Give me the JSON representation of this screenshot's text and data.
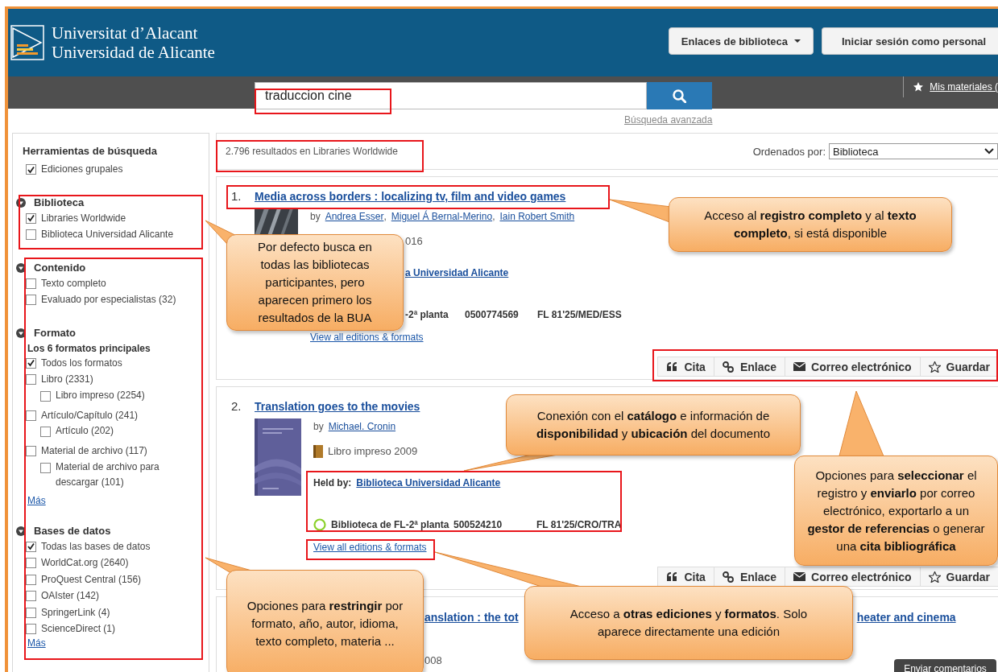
{
  "header": {
    "logo_lines": [
      "Universitat d’Alacant",
      "Universidad de Alicante"
    ],
    "buttons": [
      {
        "label": "Enlaces de biblioteca",
        "kind": "dropdown"
      },
      {
        "label": "Iniciar sesión como personal",
        "kind": "plain"
      }
    ]
  },
  "search": {
    "value": "traduccion cine",
    "advanced_link": "Búsqueda avanzada",
    "my_materials": "Mis materiales ("
  },
  "sidebar": {
    "title": "Herramientas de búsqueda",
    "options": [
      {
        "label": "Ediciones grupales",
        "checked": true
      }
    ],
    "sections": [
      {
        "title": "Biblioteca",
        "items": [
          {
            "label": "Libraries Worldwide",
            "checked": true
          },
          {
            "label": "Biblioteca Universidad Alicante",
            "checked": false
          }
        ]
      },
      {
        "title": "Contenido",
        "items": [
          {
            "label": "Texto completo",
            "checked": false
          },
          {
            "label": "Evaluado por especialistas (32)",
            "checked": false
          }
        ]
      },
      {
        "title": "Formato",
        "subtitle": "Los 6 formatos principales",
        "items": [
          {
            "label": "Todos los formatos",
            "checked": true
          },
          {
            "label": "Libro (2331)",
            "checked": false,
            "children": [
              {
                "label": "Libro impreso (2254)",
                "checked": false
              }
            ]
          },
          {
            "label": "Artículo/Capítulo (241)",
            "checked": false,
            "children": [
              {
                "label": "Artículo (202)",
                "checked": false
              }
            ]
          },
          {
            "label": "Material de archivo (117)",
            "checked": false,
            "children": [
              {
                "label": "Material de archivo para descargar (101)",
                "checked": false
              }
            ]
          }
        ],
        "more": "Más"
      },
      {
        "title": "Bases de datos",
        "items": [
          {
            "label": "Todas las bases de datos",
            "checked": true
          },
          {
            "label": "WorldCat.org (2640)",
            "checked": false
          },
          {
            "label": "ProQuest Central (156)",
            "checked": false
          },
          {
            "label": "OAIster (142)",
            "checked": false
          },
          {
            "label": "SpringerLink (4)",
            "checked": false
          },
          {
            "label": "ScienceDirect (1)",
            "checked": false
          }
        ],
        "more": "Más"
      }
    ]
  },
  "results": {
    "summary": "2.796 resultados en Libraries Worldwide",
    "sort_label": "Ordenados por:",
    "sort_value": "Biblioteca",
    "items": [
      {
        "kind": "full",
        "number": "1.",
        "title": "Media across borders : localizing tv, film and video games",
        "by": "by",
        "authors": [
          "Andrea Esser",
          "Miguel Á Bernal-Merino",
          "Iain Robert Smith"
        ],
        "author_separator": ",",
        "format": {
          "text": "016",
          "partly_hidden": true
        },
        "held_by": {
          "link": "a Universidad Alicante",
          "partly_hidden": true
        },
        "holding": {
          "location": "-2ª planta",
          "barcode": "0500774569",
          "call_number": "FL 81'25/MED/ESS",
          "partly_hidden": true
        },
        "view_all": "View all editions & formats",
        "actions": [
          {
            "label": "Cita",
            "kind": "cite"
          },
          {
            "label": "Enlace",
            "kind": "link"
          },
          {
            "label": "Correo electrónico",
            "kind": "email"
          },
          {
            "label": "Guardar",
            "kind": "save"
          }
        ]
      },
      {
        "kind": "full",
        "number": "2.",
        "title": "Translation goes to the movies",
        "by": "by",
        "authors": [
          "Michael. Cronin"
        ],
        "format": {
          "text": "Libro impreso 2009",
          "partly_hidden": false
        },
        "held_by": {
          "label": "Held by:",
          "link": "Biblioteca Universidad Alicante",
          "partly_hidden": false
        },
        "holding": {
          "location": "Biblioteca de FL-2ª planta",
          "barcode": "500524210",
          "call_number": "FL 81'25/CRO/TRA",
          "partly_hidden": false
        },
        "view_all": "View all editions & formats",
        "actions": [
          {
            "label": "Cita",
            "kind": "cite"
          },
          {
            "label": "Enlace",
            "kind": "link"
          },
          {
            "label": "Correo electrónico",
            "kind": "email"
          },
          {
            "label": "Guardar",
            "kind": "save"
          }
        ]
      },
      {
        "kind": "partial",
        "title_parts": [
          "anslation : the tot",
          "heater and cinema"
        ],
        "format": {
          "text": "008",
          "partly_hidden": true
        }
      }
    ]
  },
  "feedback_button": "Enviar comentarios",
  "callouts": [
    {
      "text": "Por defecto busca en todas las bibliotecas participantes, pero aparecen primero los resultados de la BUA"
    },
    {
      "text": "Acceso al **registro completo** y al **texto completo**, si está disponible"
    },
    {
      "text": "Conexión con el **catálogo** e información de **disponibilidad** y **ubicación** del documento"
    },
    {
      "text": "Opciones para **seleccionar** el registro y **enviarlo** por correo electrónico, exportarlo a un **gestor de referencias** o generar una **cita bibliográfica**"
    },
    {
      "text": "Opciones para **restringir** por formato, año, autor, idioma, texto completo, materia ..."
    },
    {
      "text": "Acceso a **otras ediciones** y **formatos**. Solo aparece directamente una edición"
    }
  ]
}
